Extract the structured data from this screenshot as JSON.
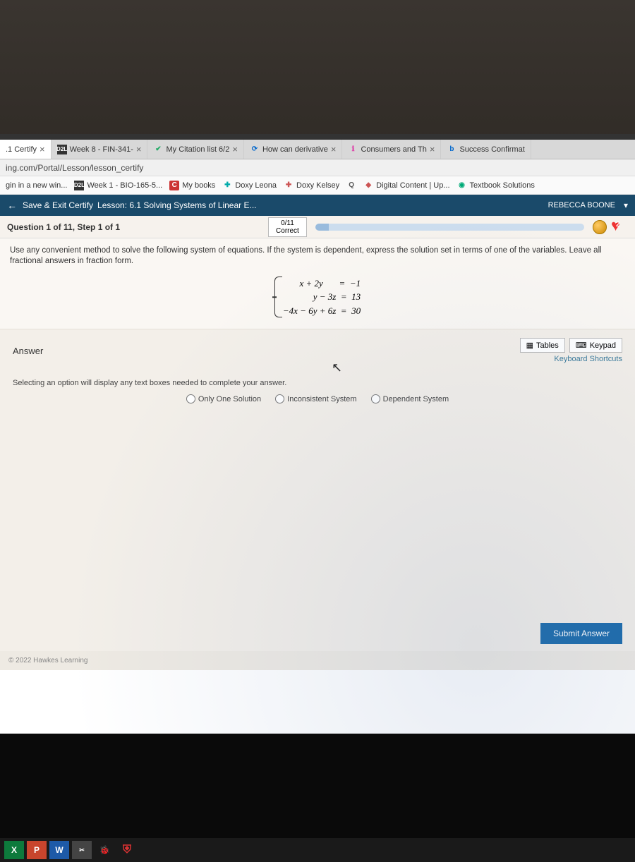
{
  "tabs": [
    {
      "label": ".1 Certify",
      "close": "×"
    },
    {
      "label": "Week 8 - FIN-341-",
      "favicon": "D2L",
      "close": "×"
    },
    {
      "label": "My Citation list 6/2",
      "favicon": "✔",
      "close": "×"
    },
    {
      "label": "How can derivative",
      "favicon": "⟳",
      "close": "×"
    },
    {
      "label": "Consumers and Th",
      "favicon": "ℹ",
      "close": "×"
    },
    {
      "label": "Success Confirmat",
      "favicon": "b"
    }
  ],
  "address_bar": "ing.com/Portal/Lesson/lesson_certify",
  "bookmarks": [
    {
      "label": "gin in a new win..."
    },
    {
      "label": "Week 1 - BIO-165-5...",
      "icon": "D2L"
    },
    {
      "label": "My books",
      "icon": "C"
    },
    {
      "label": "Doxy Leona",
      "icon": "✚"
    },
    {
      "label": "Doxy Kelsey",
      "icon": "✚"
    },
    {
      "label": "",
      "icon": "Q"
    },
    {
      "label": "Digital Content | Up...",
      "icon": "◆"
    },
    {
      "label": "Textbook Solutions",
      "icon": "◉"
    }
  ],
  "topbar": {
    "back": "←",
    "save_exit": "Save & Exit Certify",
    "lesson": "Lesson: 6.1 Solving Systems of Linear E...",
    "user": "REBECCA BOONE",
    "caret": "▾"
  },
  "qbar": {
    "title": "Question 1 of 11, Step 1 of 1",
    "correct_num": "0/11",
    "correct_label": "Correct",
    "hearts": "2"
  },
  "instruction": "Use any convenient method to solve the following system of equations. If the system is dependent, express the solution set in terms of one of the variables. Leave all fractional answers in fraction form.",
  "equations": {
    "l1": "      x + 2y       =  −1",
    "l2": "          y − 3z  =  13",
    "l3": "−4x − 6y + 6z  =  30"
  },
  "answer": {
    "label": "Answer",
    "tables": "Tables",
    "keypad": "Keypad",
    "shortcuts": "Keyboard Shortcuts",
    "hint": "Selecting an option will display any text boxes needed to complete your answer.",
    "opt1": "Only One Solution",
    "opt2": "Inconsistent System",
    "opt3": "Dependent System"
  },
  "submit": "Submit Answer",
  "copyright": "© 2022 Hawkes Learning"
}
